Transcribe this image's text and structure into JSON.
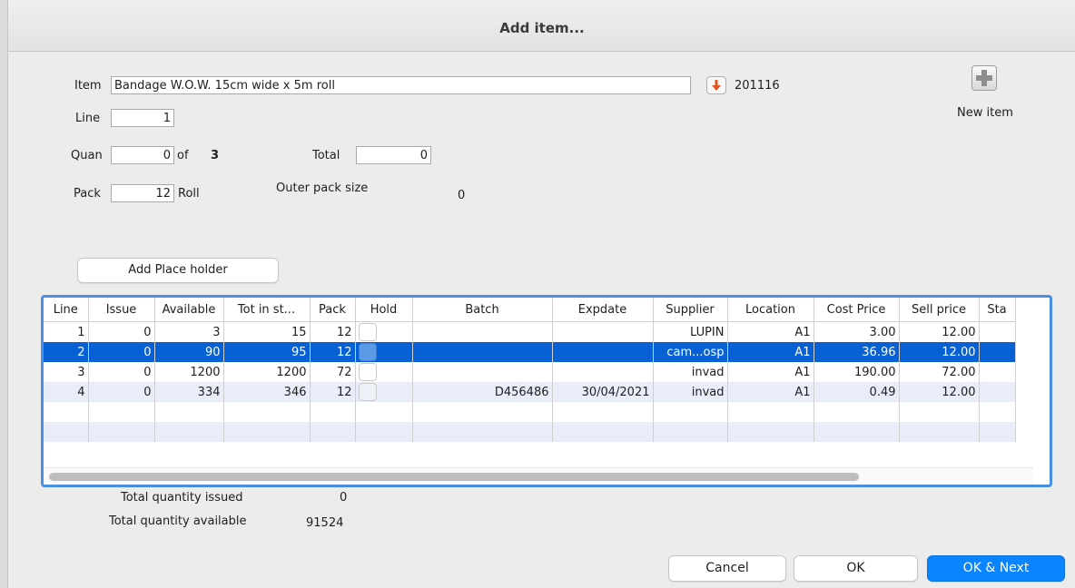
{
  "window": {
    "title": "Add item..."
  },
  "item": {
    "label": "Item",
    "value": "Bandage W.O.W. 15cm wide x 5m roll",
    "code": "201116"
  },
  "new_item": {
    "label": "New item",
    "icon": "plus-icon"
  },
  "line": {
    "label": "Line",
    "value": "1"
  },
  "quan": {
    "label": "Quan",
    "value": "0",
    "of_label": "of",
    "of_value": "3"
  },
  "total": {
    "label": "Total",
    "value": "0"
  },
  "pack": {
    "label": "Pack",
    "value": "12",
    "unit": "Roll"
  },
  "outer_pack": {
    "label": "Outer pack size",
    "value": "0"
  },
  "placeholder_button": "Add Place holder",
  "table": {
    "columns": [
      "Line",
      "Issue",
      "Available",
      "Tot in st...",
      "Pack",
      "Hold",
      "Batch",
      "Expdate",
      "Supplier",
      "Location",
      "Cost Price",
      "Sell price",
      "Sta"
    ],
    "rows": [
      {
        "line": "1",
        "issue": "0",
        "available": "3",
        "tot": "15",
        "pack": "12",
        "hold": false,
        "batch": "",
        "expdate": "",
        "supplier": "LUPIN",
        "location": "A1",
        "cost": "3.00",
        "sell": "12.00",
        "sta": ""
      },
      {
        "line": "2",
        "issue": "0",
        "available": "90",
        "tot": "95",
        "pack": "12",
        "hold": false,
        "batch": "",
        "expdate": "",
        "supplier": "cam...osp",
        "location": "A1",
        "cost": "36.96",
        "sell": "12.00",
        "sta": "",
        "selected": true
      },
      {
        "line": "3",
        "issue": "0",
        "available": "1200",
        "tot": "1200",
        "pack": "72",
        "hold": false,
        "batch": "",
        "expdate": "",
        "supplier": "invad",
        "location": "A1",
        "cost": "190.00",
        "sell": "72.00",
        "sta": ""
      },
      {
        "line": "4",
        "issue": "0",
        "available": "334",
        "tot": "346",
        "pack": "12",
        "hold": false,
        "batch": "D456486",
        "expdate": "30/04/2021",
        "supplier": "invad",
        "location": "A1",
        "cost": "0.49",
        "sell": "12.00",
        "sta": ""
      }
    ]
  },
  "totals": {
    "issued_label": "Total quantity issued",
    "issued_value": "0",
    "available_label": "Total quantity available",
    "available_value": "91524"
  },
  "buttons": {
    "cancel": "Cancel",
    "ok": "OK",
    "ok_next": "OK & Next"
  },
  "colors": {
    "accent": "#0a84ff",
    "selection": "#0760d4",
    "focus_ring": "#4a90e2",
    "arrow": "#e0531f"
  }
}
